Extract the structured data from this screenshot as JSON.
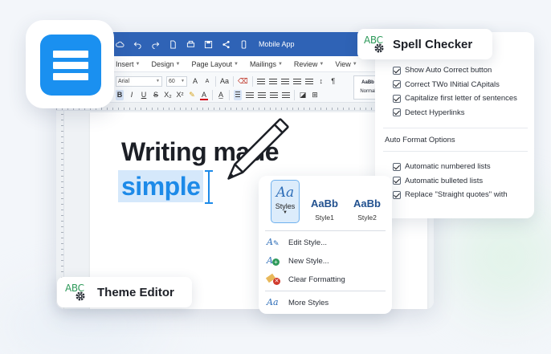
{
  "app": {
    "window_title": "Mobile App",
    "menus": [
      "Insert",
      "Design",
      "Page Layout",
      "Mailings",
      "Review",
      "View"
    ],
    "font_name": "Arial",
    "font_size": "60",
    "style_preview": {
      "sample": "AaBb",
      "name": "Normal"
    },
    "ribbon_row1": [
      "A",
      "A",
      "Aa",
      "¶"
    ],
    "ribbon_row2": [
      "B",
      "I",
      "U",
      "S",
      "X₂",
      "X²",
      "A"
    ]
  },
  "headline": {
    "line1": "Writing made",
    "line2": "simple"
  },
  "spell_checker": {
    "icon_text": "ABC",
    "title": "Spell Checker",
    "options": [
      "Show Auto Correct button",
      "Correct TWo INitial CApitals",
      "Capitalize first letter of sentences",
      "Detect Hyperlinks"
    ],
    "auto_format_title": "Auto Format Options",
    "auto_format_options": [
      "Automatic numbered lists",
      "Automatic bulleted lists",
      "Replace \"Straight quotes\" with"
    ]
  },
  "styles_popup": {
    "button_icon": "Aa",
    "button_label": "Styles",
    "samples": [
      {
        "preview": "AaBb",
        "name": "Style1"
      },
      {
        "preview": "AaBb",
        "name": "Style2"
      }
    ],
    "items": [
      "Edit Style...",
      "New Style...",
      "Clear Formatting",
      "More Styles"
    ]
  },
  "theme_editor": {
    "icon_text": "ABC",
    "title": "Theme Editor"
  },
  "colors": {
    "accent": "#1a90f0",
    "titlebar": "#2f63b6",
    "highlight_bg": "#d5e8fb",
    "highlight_text": "#1d8ae8",
    "abc_green": "#2e9a5a"
  }
}
